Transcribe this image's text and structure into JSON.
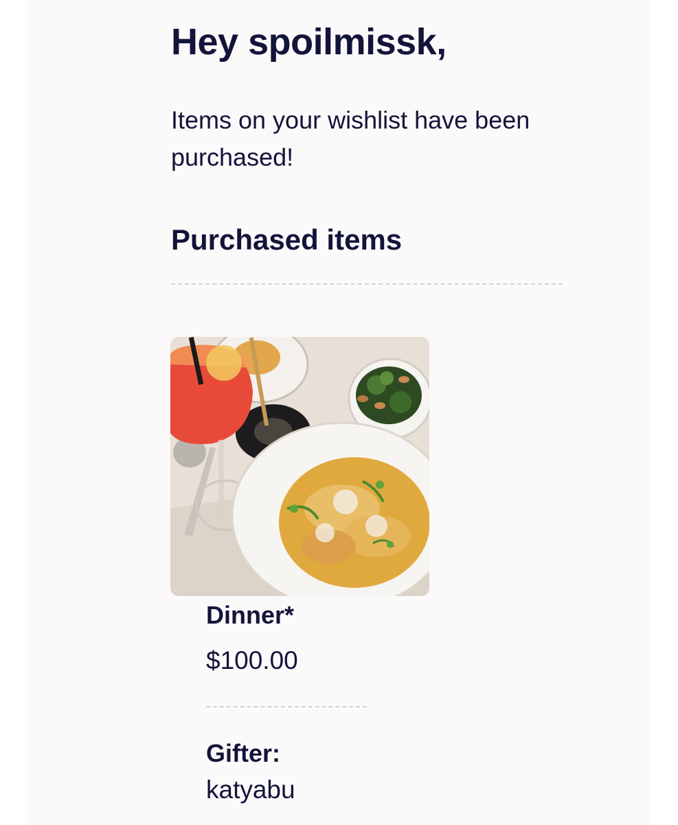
{
  "email": {
    "greeting": "Hey spoilmissk,",
    "intro": "Items on your wishlist have been purchased!",
    "section_title": "Purchased items"
  },
  "purchased_items": [
    {
      "image_alt": "Dinner photo",
      "name": "Dinner*",
      "price": "$100.00",
      "gifter_label": "Gifter:",
      "gifter": "katyabu"
    }
  ]
}
